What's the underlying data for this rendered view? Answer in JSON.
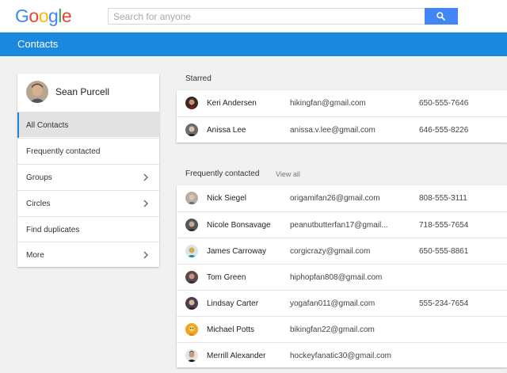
{
  "logo": {
    "letters": [
      "G",
      "o",
      "o",
      "g",
      "l",
      "e"
    ],
    "colors": [
      "#4285f4",
      "#ea4335",
      "#fbbc05",
      "#4285f4",
      "#34a853",
      "#ea4335"
    ]
  },
  "search": {
    "placeholder": "Search for anyone",
    "value": ""
  },
  "appbar": {
    "title": "Contacts",
    "color": "#1a88dc"
  },
  "profile": {
    "name": "Sean Purcell"
  },
  "nav": {
    "items": [
      {
        "label": "All Contacts",
        "active": true
      },
      {
        "label": "Frequently contacted"
      },
      {
        "label": "Groups",
        "icon": "chevron-right-icon"
      },
      {
        "label": "Circles",
        "icon": "chevron-right-icon"
      },
      {
        "label": "Find duplicates"
      },
      {
        "label": "More",
        "icon": "chevron-right-icon"
      }
    ]
  },
  "starred": {
    "label": "Starred",
    "contacts": [
      {
        "name": "Keri Andersen",
        "email": "hikingfan@gmail.com",
        "phone": "650-555-7646"
      },
      {
        "name": "Anissa Lee",
        "email": "anissa.v.lee@gmail.com",
        "phone": "646-555-8226"
      }
    ]
  },
  "frequent": {
    "label": "Frequently contacted",
    "view_all": "View all",
    "contacts": [
      {
        "name": "Nick Siegel",
        "email": "origamifan26@gmail.com",
        "phone": "808-555-3111"
      },
      {
        "name": "Nicole Bonsavage",
        "email": "peanutbutterfan17@gmail...",
        "phone": "718-555-7654"
      },
      {
        "name": "James Carroway",
        "email": "corgicrazy@gmail.com",
        "phone": "650-555-8861"
      },
      {
        "name": "Tom Green",
        "email": "hiphopfan808@gmail.com",
        "phone": ""
      },
      {
        "name": "Lindsay Carter",
        "email": "yogafan011@gmail.com",
        "phone": "555-234-7654"
      },
      {
        "name": "Michael Potts",
        "email": "bikingfan22@gmail.com",
        "phone": ""
      },
      {
        "name": "Merrill Alexander",
        "email": "hockeyfanatic30@gmail.com",
        "phone": ""
      }
    ]
  }
}
